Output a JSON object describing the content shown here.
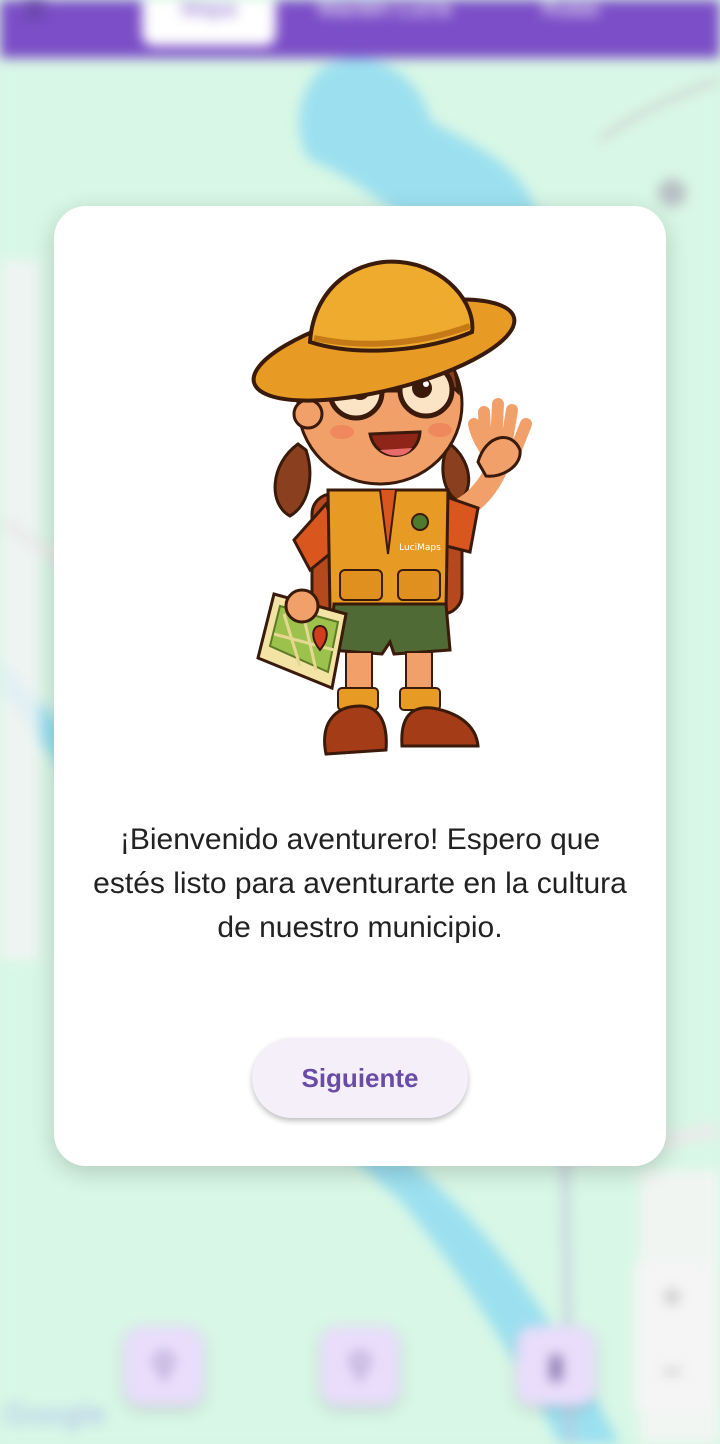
{
  "topbar": {
    "menu_icon": "menu-icon",
    "tabs": [
      {
        "label": "Mapa",
        "active": true
      },
      {
        "label": "Mantén Lucía"
      },
      {
        "label": "Rutas"
      }
    ]
  },
  "map": {
    "zoom_in_label": "+",
    "zoom_out_label": "−",
    "attribution": "Google"
  },
  "fabs": [
    {
      "icon": "search-icon"
    },
    {
      "icon": "search-icon"
    },
    {
      "icon": "book-icon"
    }
  ],
  "dialog": {
    "mascot_badge": "LuciMaps",
    "message": "¡Bienvenido aventurero! Espero que estés listo para aventurarte en la cultura de nuestro municipio.",
    "next_label": "Siguiente"
  },
  "colors": {
    "topbar": "#6a36c0",
    "map_land": "#d3f6e3",
    "map_water": "#8fdcee",
    "button_text": "#6a4ba8",
    "button_bg": "#f4eff9"
  }
}
